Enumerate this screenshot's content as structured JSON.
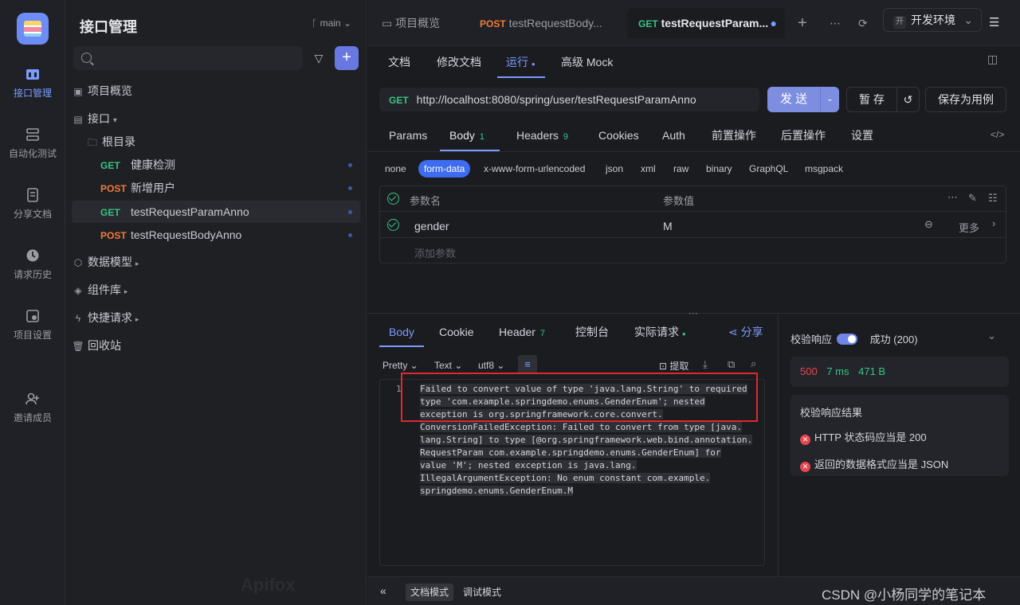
{
  "rail": {
    "items": [
      {
        "label": "接口管理",
        "icon": "api-icon"
      },
      {
        "label": "自动化测试",
        "icon": "automation-icon"
      },
      {
        "label": "分享文档",
        "icon": "share-doc-icon"
      },
      {
        "label": "请求历史",
        "icon": "history-icon"
      },
      {
        "label": "项目设置",
        "icon": "settings-icon"
      },
      {
        "label": "邀请成员",
        "icon": "invite-icon"
      }
    ]
  },
  "sidebar": {
    "title": "接口管理",
    "branch": "main",
    "tree": {
      "overview": "项目概览",
      "interfaces": "接口",
      "root": "根目录",
      "endpoints": [
        {
          "method": "GET",
          "name": "健康检测"
        },
        {
          "method": "POST",
          "name": "新增用户"
        },
        {
          "method": "GET",
          "name": "testRequestParamAnno"
        },
        {
          "method": "POST",
          "name": "testRequestBodyAnno"
        }
      ],
      "models": "数据模型",
      "components": "组件库",
      "quick": "快捷请求",
      "trash": "回收站"
    },
    "watermark": "Apifox"
  },
  "tabs": {
    "overview": "项目概览",
    "tab1_method": "POST",
    "tab1_name": "testRequestBody...",
    "tab2_method": "GET",
    "tab2_name": "testRequestParam...",
    "env": "开发环境",
    "env_badge": "开"
  },
  "doc_tabs": [
    "文档",
    "修改文档",
    "运行",
    "高级 Mock"
  ],
  "request": {
    "method": "GET",
    "url": "http://localhost:8080/spring/user/testRequestParamAnno",
    "send": "发 送",
    "save": "暂 存",
    "save_case": "保存为用例"
  },
  "param_tabs": [
    {
      "label": "Params",
      "count": ""
    },
    {
      "label": "Body",
      "count": "1"
    },
    {
      "label": "Headers",
      "count": "9"
    },
    {
      "label": "Cookies",
      "count": ""
    },
    {
      "label": "Auth",
      "count": ""
    },
    {
      "label": "前置操作",
      "count": ""
    },
    {
      "label": "后置操作",
      "count": ""
    },
    {
      "label": "设置",
      "count": ""
    }
  ],
  "body_types": [
    "none",
    "form-data",
    "x-www-form-urlencoded",
    "json",
    "xml",
    "raw",
    "binary",
    "GraphQL",
    "msgpack"
  ],
  "params_table": {
    "col_name": "参数名",
    "col_value": "参数值",
    "row": {
      "name": "gender",
      "value": "M",
      "more": "更多"
    },
    "add_placeholder": "添加参数"
  },
  "response_tabs": [
    {
      "label": "Body",
      "count": ""
    },
    {
      "label": "Cookie",
      "count": ""
    },
    {
      "label": "Header",
      "count": "7"
    },
    {
      "label": "控制台",
      "count": ""
    },
    {
      "label": "实际请求",
      "count": ""
    }
  ],
  "share": "分享",
  "format": {
    "pretty": "Pretty",
    "text": "Text",
    "encoding": "utf8",
    "extract": "提取"
  },
  "code": {
    "line": "1",
    "lines": [
      "Failed to convert value of type 'java.lang.String' to required",
      "type 'com.example.springdemo.enums.GenderEnum'; nested",
      "exception is org.springframework.core.convert.",
      "ConversionFailedException: Failed to convert from type [java.",
      "lang.String] to type [@org.springframework.web.bind.annotation.",
      "RequestParam com.example.springdemo.enums.GenderEnum] for",
      "value 'M'; nested exception is java.lang.",
      "IllegalArgumentException: No enum constant com.example.",
      "springdemo.enums.GenderEnum.M"
    ]
  },
  "validation": {
    "label": "校验响应",
    "status": "成功 (200)",
    "code": "500",
    "time": "7 ms",
    "size": "471 B",
    "result_title": "校验响应结果",
    "results": [
      "HTTP 状态码应当是 200",
      "返回的数据格式应当是 JSON"
    ]
  },
  "bottom": {
    "doc_mode": "文档模式",
    "debug_mode": "调试模式",
    "watermark": "CSDN @小杨同学的笔记本"
  },
  "colors": {
    "accent": "#7c9bff",
    "get": "#36c485",
    "post": "#f07a3a",
    "error": "#e5484d"
  }
}
